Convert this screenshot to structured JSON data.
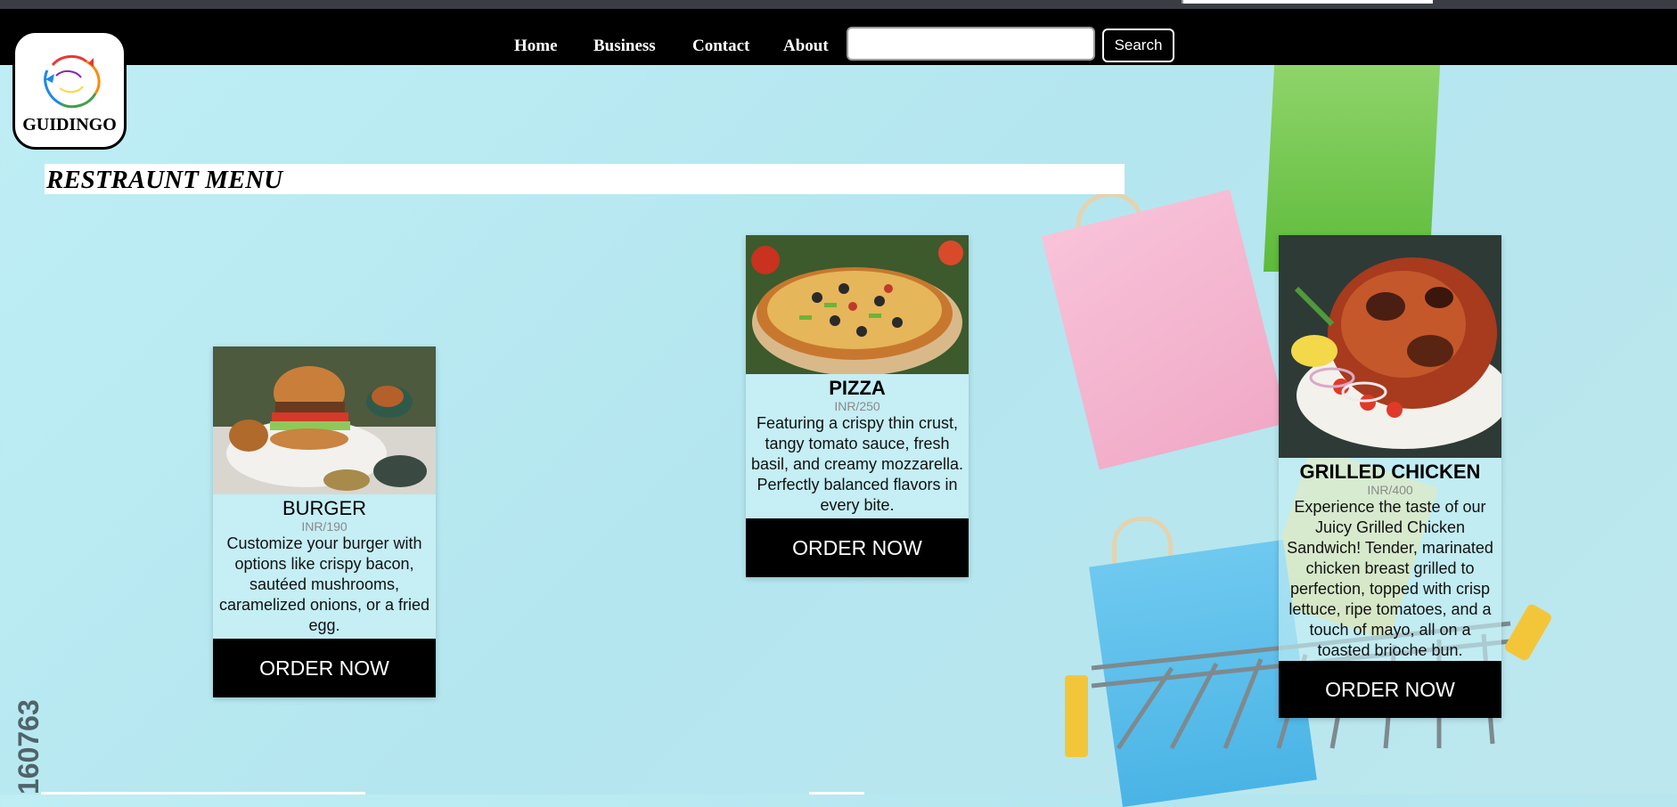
{
  "nav": {
    "links": [
      "Home",
      "Business",
      "Contact",
      "About"
    ],
    "search_placeholder": "",
    "search_button": "Search"
  },
  "logo": {
    "text": "GUIDINGO"
  },
  "menu": {
    "title": "RESTRAUNT MENU"
  },
  "items": [
    {
      "name": "BURGER",
      "price": "INR/190",
      "description": "Customize your burger with options like crispy bacon, sautéed mushrooms, caramelized onions, or a fried egg.",
      "button": "ORDER NOW"
    },
    {
      "name": "PIZZA",
      "price": "INR/250",
      "description": "Featuring a crispy thin crust, tangy tomato sauce, fresh basil, and creamy mozzarella. Perfectly balanced flavors in every bite.",
      "button": "ORDER NOW"
    },
    {
      "name": "GRILLED CHICKEN",
      "price": "INR/400",
      "description": "Experience the taste of our Juicy Grilled Chicken Sandwich! Tender, marinated chicken breast grilled to perfection, topped with crisp lettuce, ripe tomatoes, and a touch of mayo, all on a toasted brioche bun.",
      "button": "ORDER NOW"
    }
  ],
  "watermark": {
    "text": "160763"
  },
  "colors": {
    "navbar": "#000000",
    "background": "#bfeef5",
    "card": "#c5eef5",
    "button": "#000000"
  }
}
